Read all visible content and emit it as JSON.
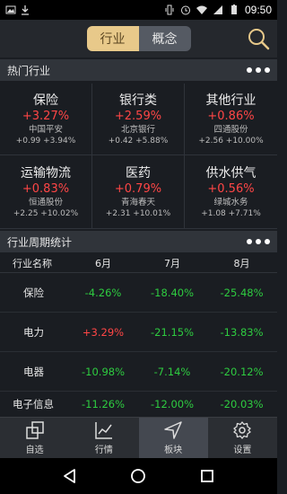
{
  "status_bar": {
    "time": "09:50"
  },
  "header": {
    "tabs": [
      "行业",
      "概念"
    ],
    "active_tab": 0
  },
  "hot_section": {
    "title": "热门行业",
    "industries": [
      {
        "name": "保险",
        "change": "+3.27%",
        "stock": "中国平安",
        "detail": "+0.99 +3.94%"
      },
      {
        "name": "银行类",
        "change": "+2.59%",
        "stock": "北京银行",
        "detail": "+0.42 +5.88%"
      },
      {
        "name": "其他行业",
        "change": "+0.86%",
        "stock": "四通股份",
        "detail": "+2.56 +10.00%"
      },
      {
        "name": "运输物流",
        "change": "+0.83%",
        "stock": "恒通股份",
        "detail": "+2.25 +10.02%"
      },
      {
        "name": "医药",
        "change": "+0.79%",
        "stock": "青海春天",
        "detail": "+2.31 +10.01%"
      },
      {
        "name": "供水供气",
        "change": "+0.56%",
        "stock": "绿城水务",
        "detail": "+1.08 +7.71%"
      }
    ]
  },
  "cycle_section": {
    "title": "行业周期统计",
    "columns": [
      "行业名称",
      "6月",
      "7月",
      "8月"
    ],
    "rows": [
      {
        "name": "保险",
        "values": [
          "-4.26%",
          "-18.40%",
          "-25.48%"
        ],
        "signs": [
          "down",
          "down",
          "down"
        ]
      },
      {
        "name": "电力",
        "values": [
          "+3.29%",
          "-21.15%",
          "-13.83%"
        ],
        "signs": [
          "up",
          "down",
          "down"
        ]
      },
      {
        "name": "电器",
        "values": [
          "-10.98%",
          "-7.14%",
          "-20.12%"
        ],
        "signs": [
          "down",
          "down",
          "down"
        ]
      },
      {
        "name": "电子信息",
        "values": [
          "-11.26%",
          "-12.00%",
          "-20.03%"
        ],
        "signs": [
          "down",
          "down",
          "down"
        ]
      }
    ]
  },
  "bottom_nav": {
    "items": [
      {
        "label": "自选",
        "icon": "watchlist-icon"
      },
      {
        "label": "行情",
        "icon": "chart-icon"
      },
      {
        "label": "板块",
        "icon": "navigation-icon"
      },
      {
        "label": "设置",
        "icon": "gear-icon"
      }
    ],
    "active": 2
  },
  "colors": {
    "up": "#ff4646",
    "down": "#2ecc40",
    "accent": "#e8c98a"
  }
}
